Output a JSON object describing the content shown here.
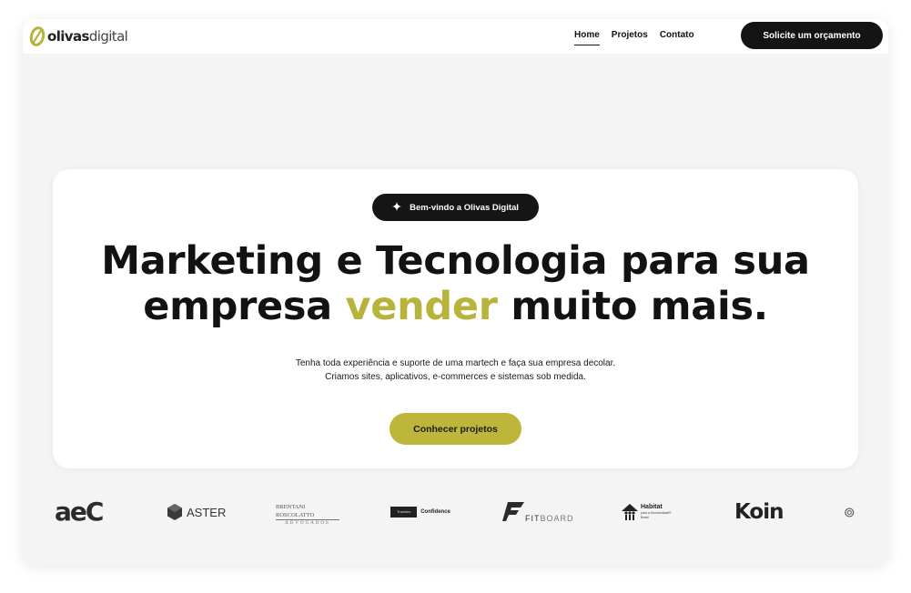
{
  "brand": {
    "name_part1": "olivas",
    "name_part2": "digital",
    "accent_color": "#b8b33a"
  },
  "nav": {
    "links": [
      {
        "label": "Home",
        "active": true
      },
      {
        "label": "Projetos",
        "active": false
      },
      {
        "label": "Contato",
        "active": false
      }
    ],
    "cta_label": "Solicite um orçamento"
  },
  "hero": {
    "badge_icon": "sparkle-icon",
    "badge_text": "Bem-vindo a Olivas Digital",
    "headline_line1": "Marketing e Tecnologia para sua",
    "headline_line2_start": "empresa",
    "headline_accent": "vender",
    "headline_line2_end": "muito mais.",
    "subtext_line1": "Tenha toda experiência e suporte de uma martech e faça sua empresa decolar.",
    "subtext_line2": "Criamos sites, aplicativos, e-commerces e sistemas sob medida.",
    "button_label": "Conhecer projetos"
  },
  "clients": {
    "aec": "aeC",
    "aster": "ASTER",
    "brentani_line1": "BRENTANI ROSCOLATTO",
    "brentani_line2": "ADVOGADOS",
    "confidence_left": "Travelex",
    "confidence_right": "Confidence",
    "fitboard_fit": "FIT",
    "fitboard_board": "BOARD",
    "habitat_line1": "Habitat",
    "habitat_line2": "para a Humanidade®",
    "habitat_line3": "Brasil",
    "koin": "Koin"
  }
}
